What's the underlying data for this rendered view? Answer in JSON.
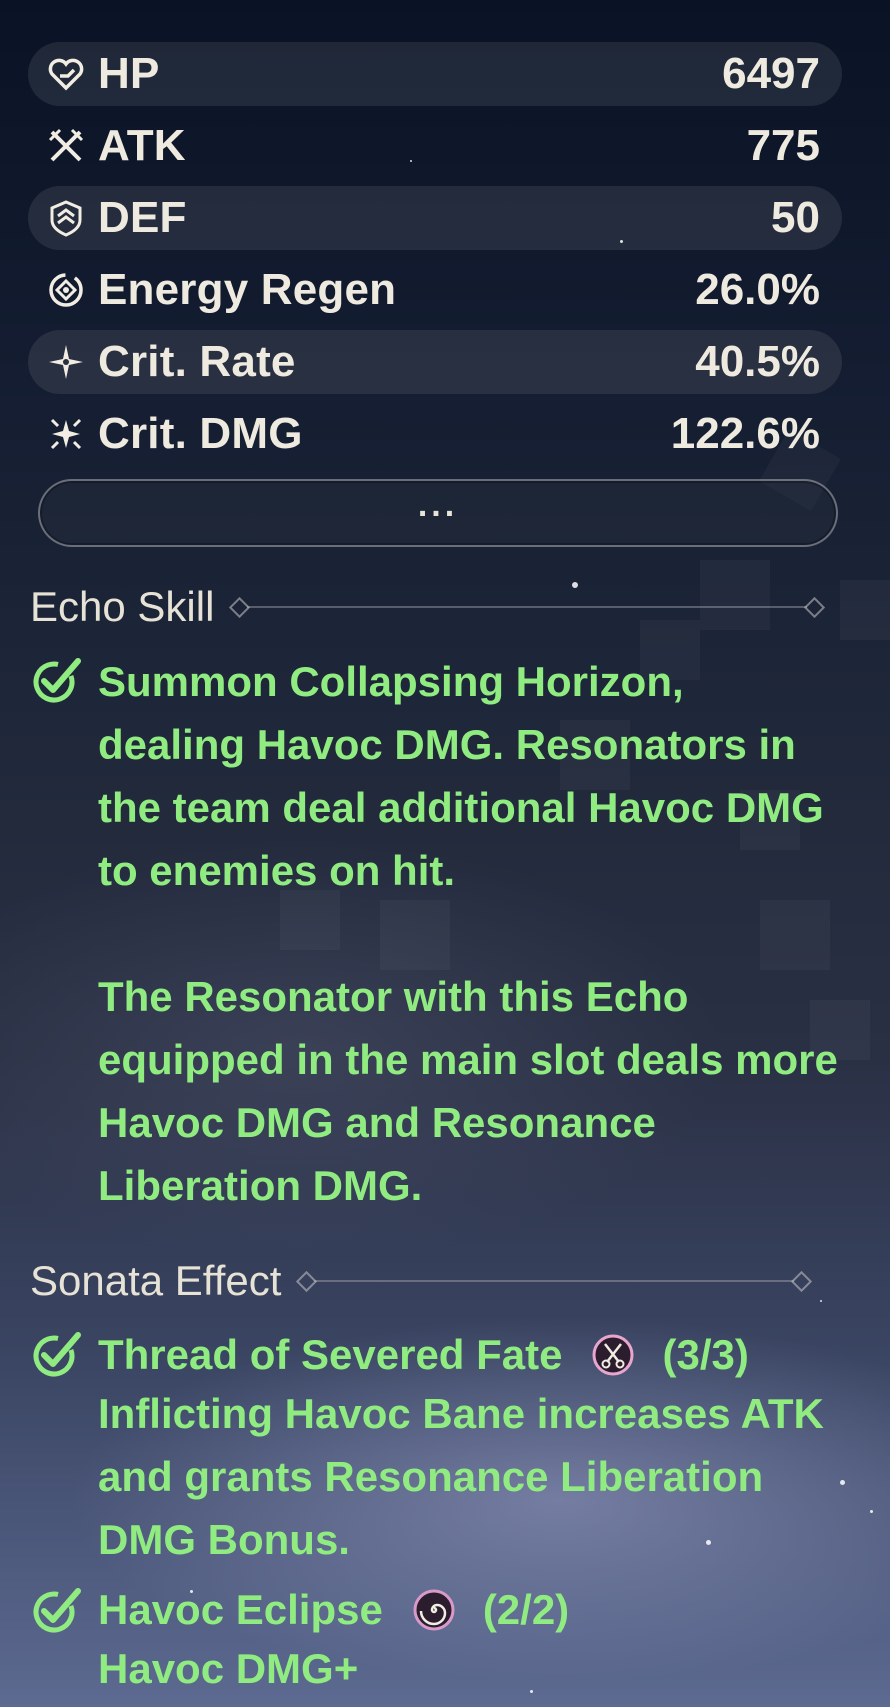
{
  "stats": [
    {
      "label": "HP",
      "value": "6497",
      "icon": "hp-heart-icon"
    },
    {
      "label": "ATK",
      "value": "775",
      "icon": "atk-swords-icon"
    },
    {
      "label": "DEF",
      "value": "50",
      "icon": "def-shield-icon"
    },
    {
      "label": "Energy Regen",
      "value": "26.0%",
      "icon": "energy-regen-icon"
    },
    {
      "label": "Crit. Rate",
      "value": "40.5%",
      "icon": "crit-rate-star-icon"
    },
    {
      "label": "Crit. DMG",
      "value": "122.6%",
      "icon": "crit-dmg-sparkle-icon"
    }
  ],
  "more_button": {
    "label": "..."
  },
  "echo_skill": {
    "title": "Echo Skill",
    "paragraphs": [
      "Summon Collapsing Horizon, dealing Havoc DMG. Resonators in the team deal additional Havoc DMG to enemies on hit.",
      "The Resonator with this Echo equipped in the main slot deals more Havoc DMG and Resonance Liberation DMG."
    ]
  },
  "sonata_effect": {
    "title": "Sonata Effect",
    "sets": [
      {
        "name": "Thread of Severed Fate",
        "count": "(3/3)",
        "icon": "scissors-icon",
        "description": "Inflicting Havoc Bane increases ATK and grants Resonance Liberation DMG Bonus."
      },
      {
        "name": "Havoc Eclipse",
        "count": "(2/2)",
        "icon": "spiral-icon",
        "description": "Havoc DMG+"
      }
    ]
  },
  "colors": {
    "effect_text": "#90ec80",
    "stat_text": "#efeadf",
    "thread_icon_ring": "#e8a6cf",
    "eclipse_icon_ring": "#d99ac9"
  }
}
